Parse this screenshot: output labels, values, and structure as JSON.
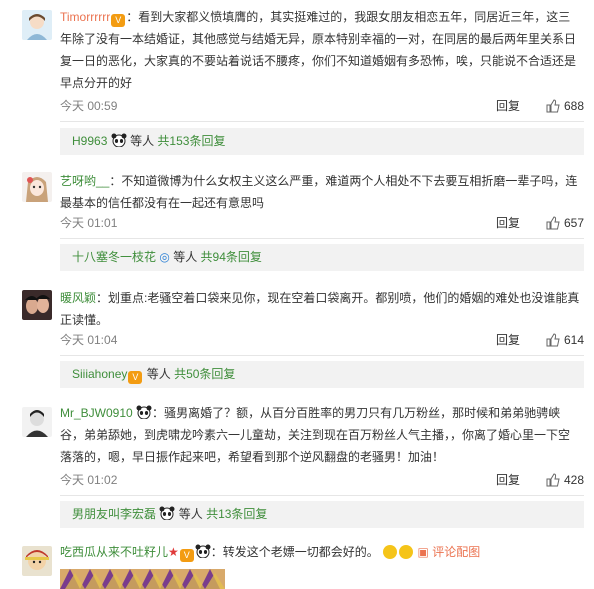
{
  "comments": [
    {
      "user": "Timorrrrrr",
      "colon": "：",
      "text": "看到大家都义愤填膺的，其实挺难过的，我跟女朋友相恋五年，同居近三年，这三年除了没有一本结婚证，其他感觉与结婚无异，原本特别幸福的一对，在同居的最后两年里关系日复一日的恶化，大家真的不要站着说话不腰疼，你们不知道婚姻有多恐怖，唉，只能说不合适还是早点分开的好",
      "time": "今天 00:59",
      "reply": "回复",
      "likes": "688",
      "sub_user": "H9963",
      "sub_etc": "等人",
      "sub_count": "共153条回复"
    },
    {
      "user": "艺呀哟__",
      "colon": "：",
      "text": "不知道微博为什么女权主义这么严重，难道两个人相处不下去要互相折磨一辈子吗，连最基本的信任都没有在一起还有意思吗",
      "time": "今天 01:01",
      "reply": "回复",
      "likes": "657",
      "sub_user": "十八塞冬一枝花",
      "sub_etc": "等人",
      "sub_count": "共94条回复"
    },
    {
      "user": "暖风颖",
      "colon": "：",
      "text": "划重点:老骚空着口袋来见你，现在空着口袋离开。都别喷，他们的婚姻的难处也没谁能真正读懂。",
      "time": "今天 01:04",
      "reply": "回复",
      "likes": "614",
      "sub_user": "Siiiahoney",
      "sub_etc": "等人",
      "sub_count": "共50条回复"
    },
    {
      "user": "Mr_BJW0910",
      "colon": "：",
      "text": "骚男离婚了？额，从百分百胜率的男刀只有几万粉丝，那时候和弟弟驰骋峡谷，弟弟舔她，到虎啸龙吟素六一儿童劫，关注到现在百万粉丝人气主播，，你离了婚心里一下空落落的，嗯，早日振作起来吧，希望看到那个逆风翻盘的老骚男！加油！",
      "time": "今天 01:02",
      "reply": "回复",
      "likes": "428",
      "sub_user": "男朋友叫李宏磊",
      "sub_etc": "等人",
      "sub_count": "共13条回复"
    },
    {
      "user": "吃西瓜从来不吐籽儿",
      "colon": "：",
      "text": "转发这个老嫖一切都会好的。",
      "pic_link": "评论配图"
    }
  ]
}
